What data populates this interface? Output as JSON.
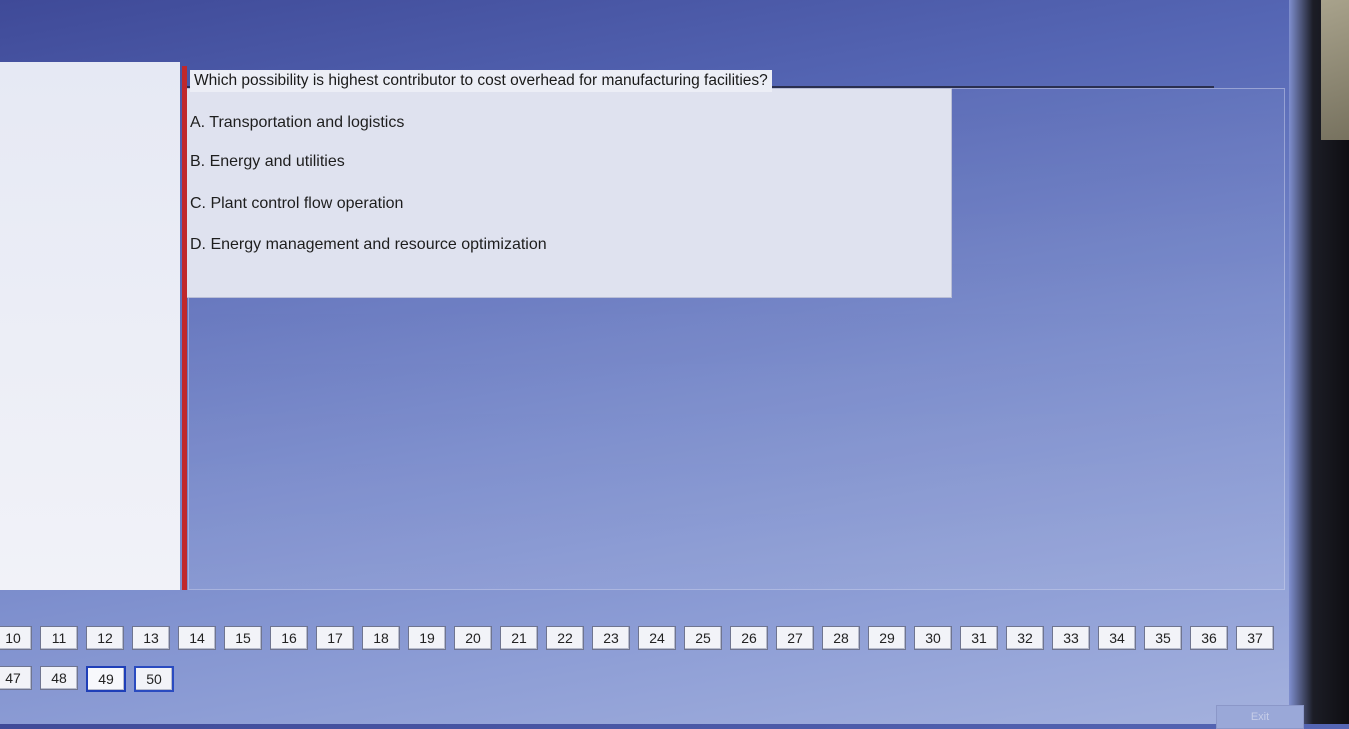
{
  "question": {
    "text": "Which possibility is highest contributor to cost overhead for manufacturing facilities?",
    "options": [
      {
        "label": "A. Transportation and logistics"
      },
      {
        "label": "B. Energy and utilities"
      },
      {
        "label": "C. Plant control flow operation"
      },
      {
        "label": "D. Energy management and resource optimization"
      }
    ]
  },
  "navigation": {
    "row1": [
      "10",
      "11",
      "12",
      "13",
      "14",
      "15",
      "16",
      "17",
      "18",
      "19",
      "20",
      "21",
      "22",
      "23",
      "24",
      "25",
      "26",
      "27",
      "28",
      "29",
      "30",
      "31",
      "32",
      "33",
      "34",
      "35",
      "36",
      "37"
    ],
    "row2": [
      "47",
      "48",
      "49",
      "50"
    ],
    "current": "49",
    "hovered": "50"
  },
  "footer": {
    "exit_label": "Exit"
  },
  "colors": {
    "accent_divider": "#c0282c",
    "current_border": "#1f3fb8"
  }
}
